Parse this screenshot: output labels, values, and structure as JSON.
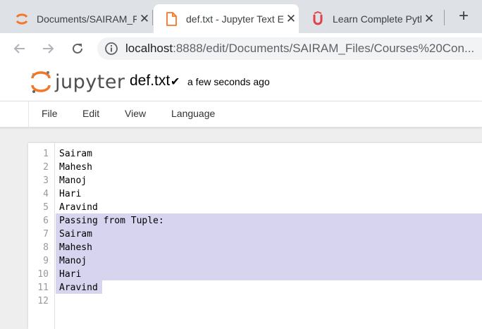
{
  "browser": {
    "tabs": [
      {
        "title": "Documents/SAIRAM_Files/",
        "icon": "jupyter-favicon",
        "active": false
      },
      {
        "title": "def.txt - Jupyter Text Editor",
        "icon": "document-icon",
        "active": true
      },
      {
        "title": "Learn Complete Python",
        "icon": "udemy-icon",
        "active": false
      }
    ],
    "close_glyph": "✕",
    "new_tab_glyph": "+",
    "url_host": "localhost",
    "url_rest": ":8888/edit/Documents/SAIRAM_Files/Courses%20Con..."
  },
  "jupyter": {
    "logo_text": "jupyter",
    "filename": "def.txt",
    "check": "✔",
    "save_status": "a few seconds ago",
    "accent": "#f37726"
  },
  "menu": {
    "items": [
      "File",
      "Edit",
      "View",
      "Language"
    ]
  },
  "editor": {
    "selection_color": "#d7d4f0",
    "lines": [
      {
        "n": "1",
        "text": "Sairam"
      },
      {
        "n": "2",
        "text": "Mahesh"
      },
      {
        "n": "3",
        "text": "Manoj"
      },
      {
        "n": "4",
        "text": "Hari"
      },
      {
        "n": "5",
        "text": "Aravind"
      },
      {
        "n": "6",
        "text": "Passing from Tuple:"
      },
      {
        "n": "7",
        "text": "Sairam"
      },
      {
        "n": "8",
        "text": "Mahesh"
      },
      {
        "n": "9",
        "text": "Manoj"
      },
      {
        "n": "10",
        "text": "Hari"
      },
      {
        "n": "11",
        "text": "Aravind"
      },
      {
        "n": "12",
        "text": ""
      }
    ]
  }
}
